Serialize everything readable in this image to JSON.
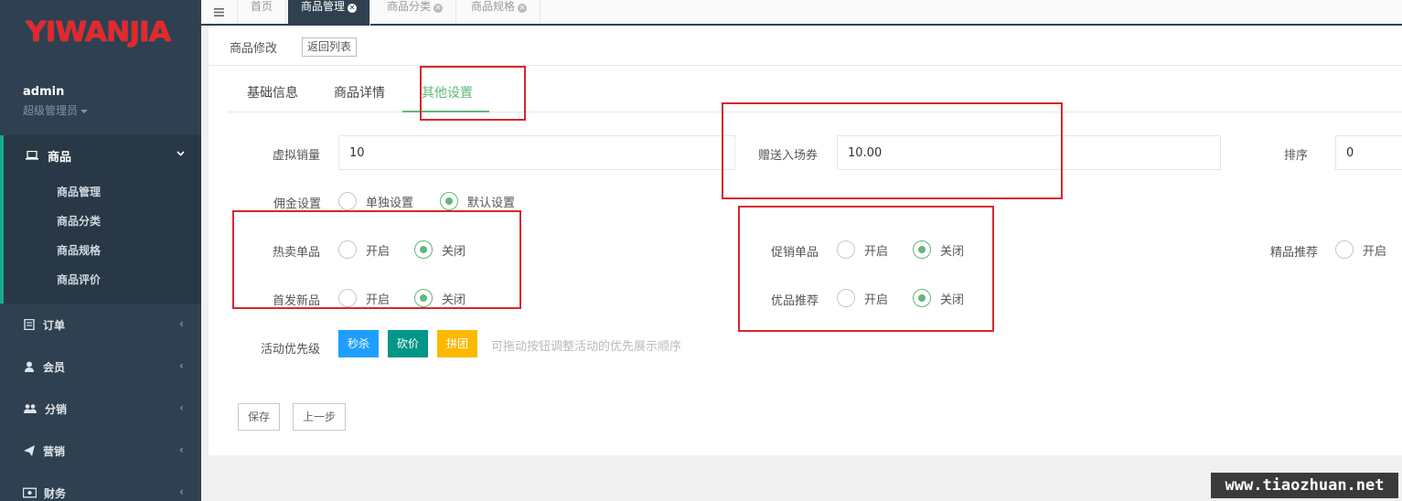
{
  "brand": {
    "logo_text": "YIWANJIA",
    "logo_color": "#e8262b"
  },
  "user": {
    "name": "admin",
    "role": "超级管理员"
  },
  "sidebar": {
    "active_group": {
      "label": "商品",
      "icon": "laptop-icon",
      "items": [
        "商品管理",
        "商品分类",
        "商品规格",
        "商品评价"
      ]
    },
    "groups": [
      {
        "label": "订单",
        "icon": "order-icon"
      },
      {
        "label": "会员",
        "icon": "user-icon"
      },
      {
        "label": "分销",
        "icon": "users-icon"
      },
      {
        "label": "营销",
        "icon": "paper-plane-icon"
      },
      {
        "label": "财务",
        "icon": "money-icon"
      }
    ]
  },
  "top_tabs": [
    {
      "label": "首页",
      "closable": false,
      "active": false
    },
    {
      "label": "商品管理",
      "closable": true,
      "active": true
    },
    {
      "label": "商品分类",
      "closable": true,
      "active": false
    },
    {
      "label": "商品规格",
      "closable": true,
      "active": false
    }
  ],
  "panel": {
    "title": "商品修改",
    "back_label": "返回列表"
  },
  "form_tabs": [
    "基础信息",
    "商品详情",
    "其他设置"
  ],
  "form_tabs_active": 2,
  "fields": {
    "virtual_sales": {
      "label": "虚拟销量",
      "value": "10"
    },
    "gift_ticket": {
      "label": "赠送入场券",
      "value": "10.00"
    },
    "sort": {
      "label": "排序",
      "value": "0"
    }
  },
  "radio_on_label": "开启",
  "radio_off_label": "关闭",
  "commission": {
    "label": "佣金设置",
    "option_individual": "单独设置",
    "option_default": "默认设置",
    "selected": "默认设置"
  },
  "toggles": {
    "hot": {
      "label": "热卖单品",
      "selected": "关闭"
    },
    "new": {
      "label": "首发新品",
      "selected": "关闭"
    },
    "promo": {
      "label": "促销单品",
      "selected": "关闭"
    },
    "quality": {
      "label": "优品推荐",
      "selected": "关闭"
    },
    "boutique": {
      "label": "精品推荐"
    }
  },
  "activity": {
    "label": "活动优先级",
    "buttons": [
      {
        "label": "秒杀",
        "color": "#1e9fff"
      },
      {
        "label": "砍价",
        "color": "#009688"
      },
      {
        "label": "拼团",
        "color": "#ffb800"
      }
    ],
    "hint": "可拖动按钮调整活动的优先展示顺序"
  },
  "actions": {
    "save": "保存",
    "prev": "上一步"
  },
  "colors": {
    "sidebar_bg": "#2f4050",
    "accent": "#5fb878",
    "highlight_box": "#d9262c"
  },
  "watermark": "www.tiaozhuan.net"
}
